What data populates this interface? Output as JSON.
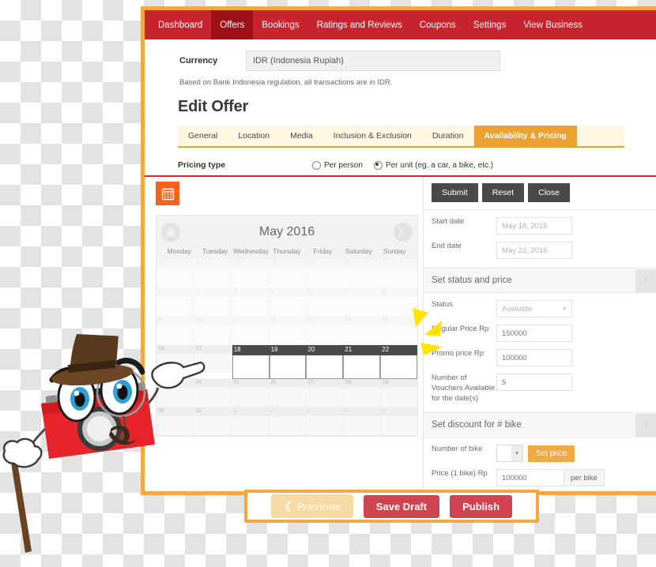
{
  "nav": {
    "items": [
      {
        "label": "Dashboard",
        "active": false
      },
      {
        "label": "Offers",
        "active": true
      },
      {
        "label": "Bookings",
        "active": false
      },
      {
        "label": "Ratings and Reviews",
        "active": false
      },
      {
        "label": "Coupons",
        "active": false
      },
      {
        "label": "Settings",
        "active": false
      },
      {
        "label": "View Business",
        "active": false
      }
    ]
  },
  "currency": {
    "label": "Currency",
    "value": "IDR (Indonesia Rupiah)",
    "note": "Based on Bank Indonesia regulation, all transactions are in IDR."
  },
  "page": {
    "title": "Edit Offer",
    "tabs": [
      {
        "label": "General",
        "active": false
      },
      {
        "label": "Location",
        "active": false
      },
      {
        "label": "Media",
        "active": false
      },
      {
        "label": "Inclusion & Exclusion",
        "active": false
      },
      {
        "label": "Duration",
        "active": false
      },
      {
        "label": "Availability & Pricing",
        "active": true
      }
    ]
  },
  "pricing_type": {
    "label": "Pricing type",
    "options": [
      {
        "label": "Per person",
        "selected": false
      },
      {
        "label": "Per unit (eg. a car, a bike, etc.)",
        "selected": true
      }
    ]
  },
  "calendar": {
    "icon": "calendar-icon",
    "month_title": "May 2016",
    "prev_icon": "circle-plus-icon",
    "next_icon": "chevron-right-circle-icon",
    "weekdays": [
      "Monday",
      "Tuesday",
      "Wednesday",
      "Thursday",
      "Friday",
      "Saturday",
      "Sunday"
    ],
    "weeks": [
      [
        {
          "day": "25",
          "out": true,
          "selected": false
        },
        {
          "day": "26",
          "out": true,
          "selected": false
        },
        {
          "day": "27",
          "out": true,
          "selected": false
        },
        {
          "day": "28",
          "out": true,
          "selected": false
        },
        {
          "day": "29",
          "out": true,
          "selected": false
        },
        {
          "day": "30",
          "out": true,
          "selected": false
        },
        {
          "day": "1",
          "out": false,
          "selected": false
        }
      ],
      [
        {
          "day": "2",
          "out": false,
          "selected": false
        },
        {
          "day": "3",
          "out": false,
          "selected": false
        },
        {
          "day": "4",
          "out": false,
          "selected": false
        },
        {
          "day": "5",
          "out": false,
          "selected": false
        },
        {
          "day": "6",
          "out": false,
          "selected": false
        },
        {
          "day": "7",
          "out": false,
          "selected": false
        },
        {
          "day": "8",
          "out": false,
          "selected": false
        }
      ],
      [
        {
          "day": "9",
          "out": false,
          "selected": false
        },
        {
          "day": "10",
          "out": false,
          "selected": false
        },
        {
          "day": "11",
          "out": false,
          "selected": false
        },
        {
          "day": "12",
          "out": false,
          "selected": false
        },
        {
          "day": "13",
          "out": false,
          "selected": false
        },
        {
          "day": "14",
          "out": false,
          "selected": false
        },
        {
          "day": "15",
          "out": false,
          "selected": false
        }
      ],
      [
        {
          "day": "16",
          "out": false,
          "selected": false
        },
        {
          "day": "17",
          "out": false,
          "selected": false
        },
        {
          "day": "18",
          "out": false,
          "selected": true
        },
        {
          "day": "19",
          "out": false,
          "selected": true
        },
        {
          "day": "20",
          "out": false,
          "selected": true
        },
        {
          "day": "21",
          "out": false,
          "selected": true
        },
        {
          "day": "22",
          "out": false,
          "selected": true
        }
      ],
      [
        {
          "day": "23",
          "out": false,
          "selected": false
        },
        {
          "day": "24",
          "out": false,
          "selected": false
        },
        {
          "day": "25",
          "out": false,
          "selected": false
        },
        {
          "day": "26",
          "out": false,
          "selected": false
        },
        {
          "day": "27",
          "out": false,
          "selected": false
        },
        {
          "day": "28",
          "out": false,
          "selected": false
        },
        {
          "day": "29",
          "out": false,
          "selected": false
        }
      ],
      [
        {
          "day": "30",
          "out": false,
          "selected": false
        },
        {
          "day": "31",
          "out": false,
          "selected": false
        },
        {
          "day": "1",
          "out": true,
          "selected": false
        },
        {
          "day": "2",
          "out": true,
          "selected": false
        },
        {
          "day": "3",
          "out": true,
          "selected": false
        },
        {
          "day": "4",
          "out": true,
          "selected": false
        },
        {
          "day": "5",
          "out": true,
          "selected": false
        }
      ]
    ]
  },
  "form": {
    "buttons": {
      "submit": "Submit",
      "reset": "Reset",
      "close": "Close"
    },
    "start_date": {
      "label": "Start date",
      "value": "May 18, 2016"
    },
    "end_date": {
      "label": "End date",
      "value": "May 22, 2016"
    },
    "status_section": {
      "title": "Set status and price",
      "collapse_icon": "collapse-up-icon",
      "status": {
        "label": "Status",
        "value": "Available"
      },
      "regular_price": {
        "label": "Regular Price Rp",
        "value": "150000"
      },
      "promo_price": {
        "label": "Promo price Rp",
        "value": "100000"
      },
      "vouchers": {
        "label": "Number of Vouchers Available for the date(s)",
        "value": "5"
      }
    },
    "discount_section": {
      "title": "Set discount for # bike",
      "collapse_icon": "collapse-up-icon",
      "number_of_bike": {
        "label": "Number of bike",
        "value": "",
        "button": "Set price"
      },
      "price_one_bike": {
        "label": "Price (1 bike) Rp",
        "value": "100000",
        "suffix": "per bike"
      }
    }
  },
  "footer": {
    "previous": "Previous",
    "previous_icon": "chevron-left-icon",
    "save_draft": "Save Draft",
    "publish": "Publish"
  },
  "mascot": {
    "name": "camera-mascot"
  },
  "colors": {
    "nav_red": "#c9232d",
    "nav_active_red": "#9e1118",
    "accent_orange": "#eaa12f",
    "window_border": "#f5a742",
    "calendar_icon_bg": "#f4631e",
    "selection_ring": "#e81c1c",
    "publish_red": "#cf4450",
    "arrow_yellow": "#ffe400"
  }
}
